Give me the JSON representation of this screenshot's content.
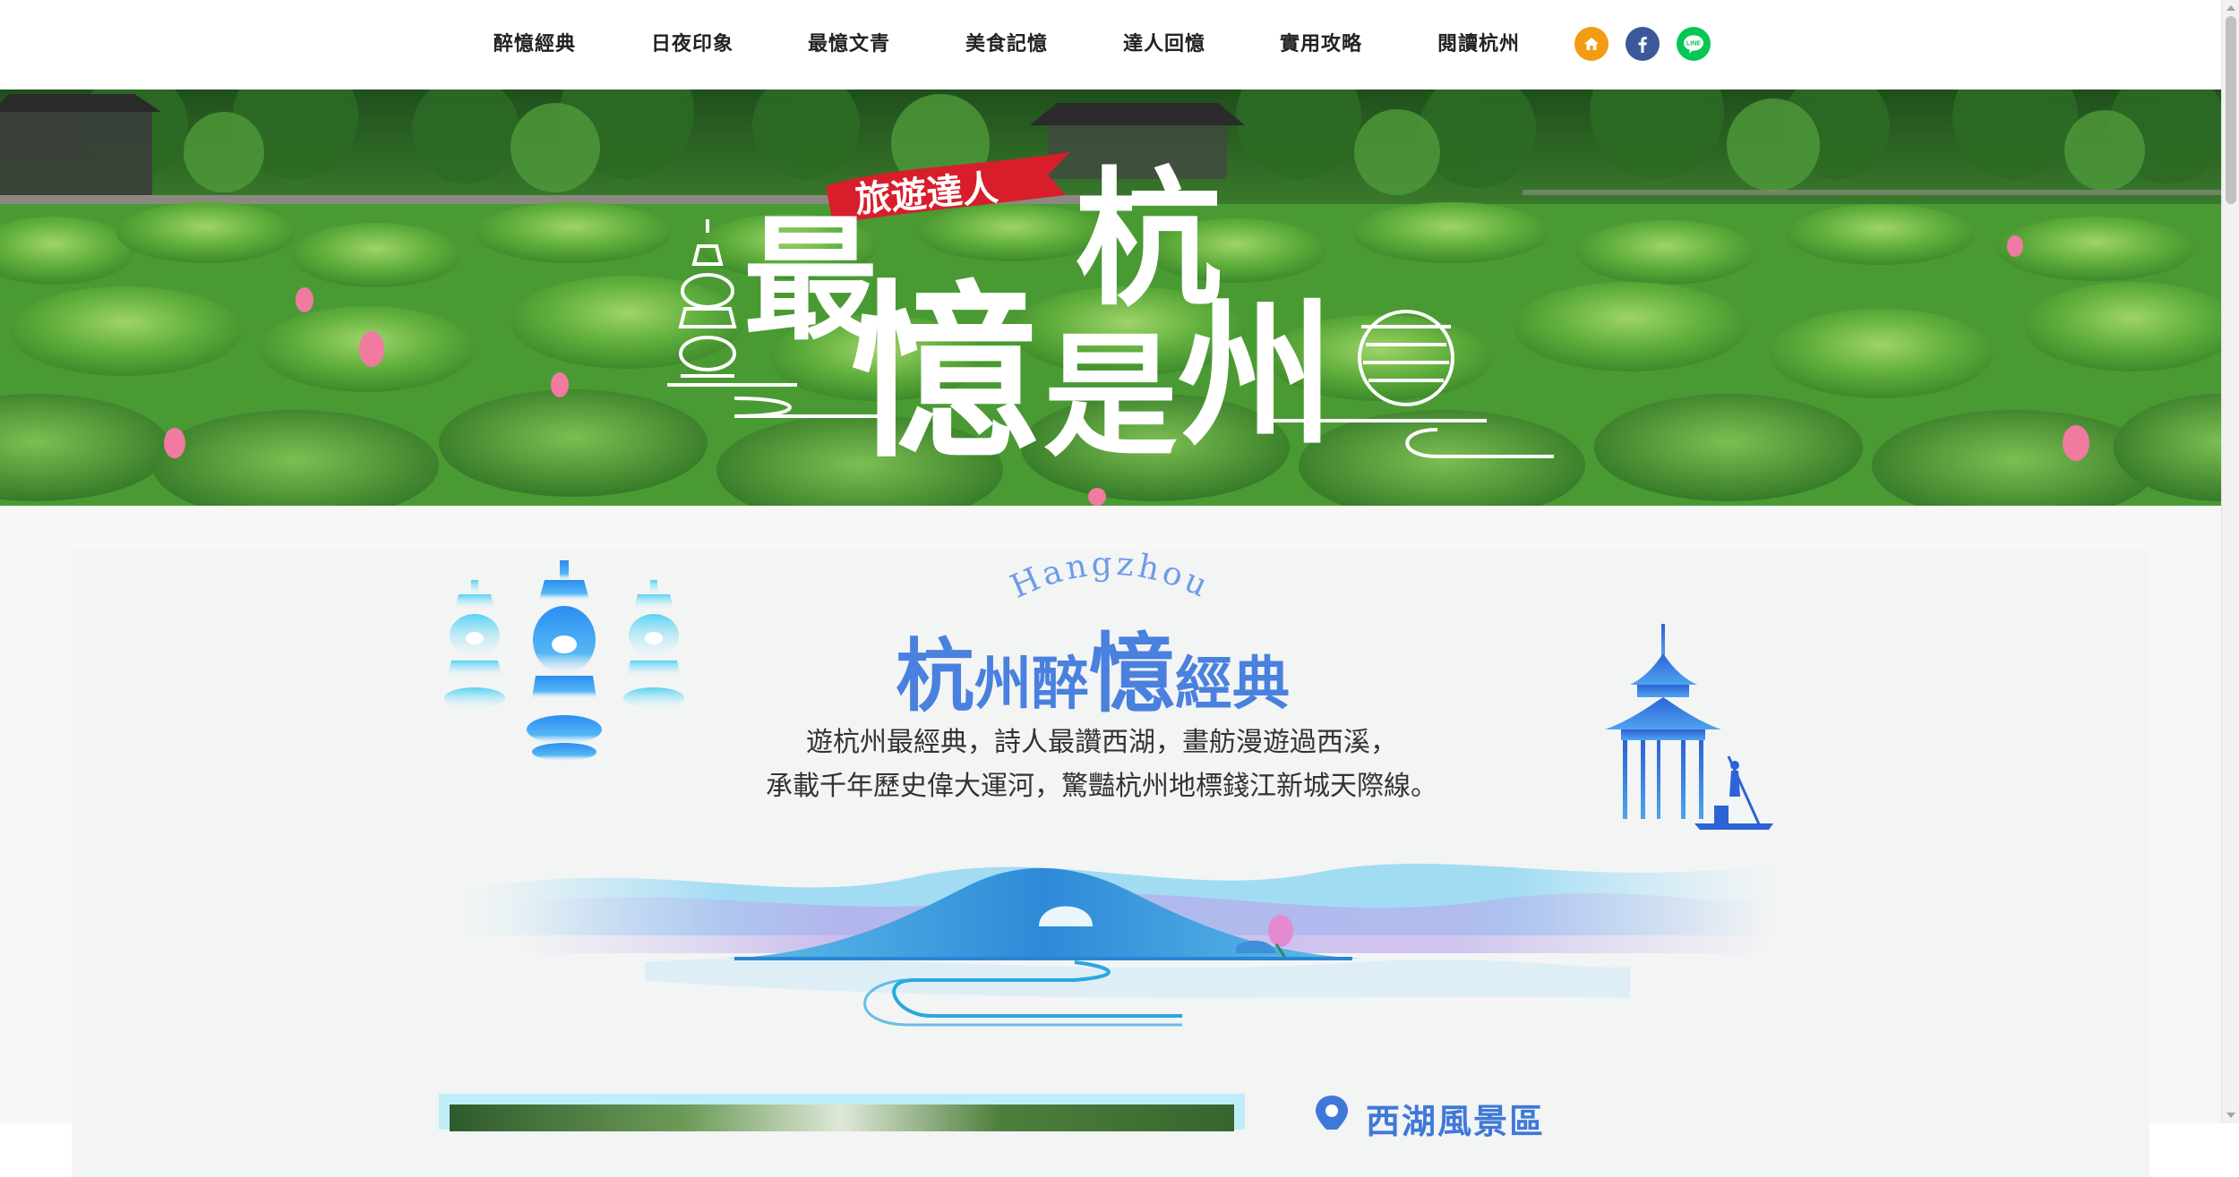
{
  "nav": {
    "items": [
      {
        "label": "醉憶經典"
      },
      {
        "label": "日夜印象"
      },
      {
        "label": "最憶文青"
      },
      {
        "label": "美食記憶"
      },
      {
        "label": "達人回憶"
      },
      {
        "label": "實用攻略"
      },
      {
        "label": "閱讀杭州"
      }
    ],
    "social": [
      {
        "icon": "home-icon",
        "color": "#f39c12"
      },
      {
        "icon": "facebook-icon",
        "color": "#3b5998"
      },
      {
        "icon": "line-icon",
        "color": "#06c755",
        "text": "LINE"
      }
    ]
  },
  "hero": {
    "badge": "旅遊達人",
    "title_chars": [
      "最",
      "憶",
      "杭",
      "是",
      "州"
    ]
  },
  "section": {
    "subtitle": "Hangzhou",
    "title_parts": [
      {
        "text": "杭"
      },
      {
        "text": "州醉"
      },
      {
        "text": "憶"
      },
      {
        "text": "經典"
      }
    ],
    "intro_lines": [
      "遊杭州最經典，詩人最讚西湖，畫舫漫遊過西溪，",
      "承載千年歷史偉大運河，驚豔杭州地標錢江新城天際線。"
    ]
  },
  "region": {
    "title": "西湖風景區"
  },
  "colors": {
    "accent_blue": "#4a80de",
    "brand_red": "#d81e2a",
    "lotus_green": "#4ea73a"
  }
}
